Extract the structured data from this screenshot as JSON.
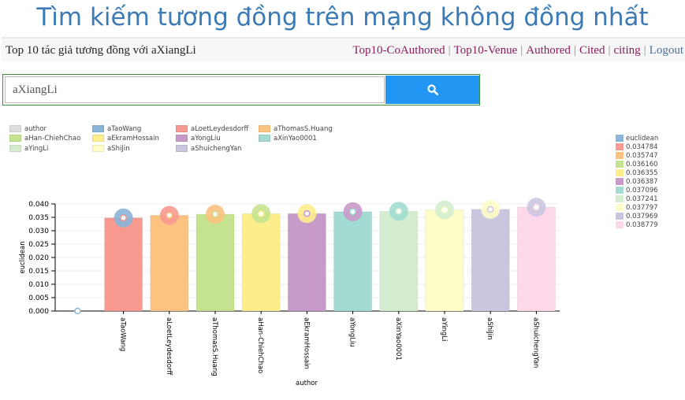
{
  "page": {
    "title": "Tìm kiếm tương đồng trên mạng không đồng nhất"
  },
  "navbar": {
    "info": "Top 10 tác giả tương đồng với aXiangLi",
    "links": [
      "Top10-CoAuthored",
      "Top10-Venue",
      "Authored",
      "Cited",
      "citing"
    ],
    "logout": "Logout"
  },
  "search": {
    "value": "aXiangLi",
    "placeholder": "aXiangLi",
    "button_icon": "search-icon"
  },
  "legend_authors": [
    {
      "label": "author",
      "color": "#dddddd"
    },
    {
      "label": "aTaoWang",
      "color": "#8ab4d8"
    },
    {
      "label": "aLoetLeydesdorff",
      "color": "#f89a90"
    },
    {
      "label": "aThomasS.Huang",
      "color": "#fbc280"
    },
    {
      "label": "aHan-ChiehChao",
      "color": "#c5e38e"
    },
    {
      "label": "aEkramHossain",
      "color": "#fdee8c"
    },
    {
      "label": "aYongLiu",
      "color": "#c89ac9"
    },
    {
      "label": "aXinYao0001",
      "color": "#a2dbd1"
    },
    {
      "label": "aYingLi",
      "color": "#d4edcf"
    },
    {
      "label": "aShiJin",
      "color": "#fefdc8"
    },
    {
      "label": "aShuichengYan",
      "color": "#cbc6e0"
    }
  ],
  "legend_values": [
    {
      "label": "euclidean",
      "color": "#8ab4d8"
    },
    {
      "label": "0.034784",
      "color": "#f89a90"
    },
    {
      "label": "0.035747",
      "color": "#fbc280"
    },
    {
      "label": "0.036160",
      "color": "#c5e38e"
    },
    {
      "label": "0.036355",
      "color": "#fdee8c"
    },
    {
      "label": "0.036387",
      "color": "#c89ac9"
    },
    {
      "label": "0.037096",
      "color": "#a2dbd1"
    },
    {
      "label": "0.037241",
      "color": "#d4edcf"
    },
    {
      "label": "0.037797",
      "color": "#fefdc8"
    },
    {
      "label": "0.037969",
      "color": "#cbc6e0"
    },
    {
      "label": "0.038779",
      "color": "#fdd8ea"
    }
  ],
  "chart_data": {
    "type": "bar",
    "xlabel": "author",
    "ylabel": "euclidean",
    "ylim": [
      0,
      0.04
    ],
    "yticks": [
      "0.000",
      "0.005",
      "0.010",
      "0.015",
      "0.020",
      "0.025",
      "0.030",
      "0.035",
      "0.040"
    ],
    "grid": true,
    "legend_position": "top-left",
    "origin_point": {
      "category": "",
      "value": 0
    },
    "categories": [
      "aTaoWang",
      "aLoetLeydesdorff",
      "aThomasS.Huang",
      "aHan-ChiehChao",
      "aEkramHossain",
      "aYongLiu",
      "aXinYao0001",
      "aYingLi",
      "aShiJin",
      "aShuichengYan"
    ],
    "values": [
      0.034784,
      0.035747,
      0.03616,
      0.036355,
      0.036387,
      0.037096,
      0.037241,
      0.037797,
      0.037969,
      0.038779
    ],
    "colors": [
      "#f89a90",
      "#fbc280",
      "#c5e38e",
      "#fdee8c",
      "#c89ac9",
      "#a2dbd1",
      "#d4edcf",
      "#fefdc8",
      "#cbc6e0",
      "#fdd8ea"
    ],
    "marker_colors": [
      "#8ab4d8",
      "#f89a90",
      "#fbc280",
      "#c5e38e",
      "#fdee8c",
      "#c89ac9",
      "#a2dbd1",
      "#d4edcf",
      "#fefdc8",
      "#cbc6e0"
    ]
  }
}
